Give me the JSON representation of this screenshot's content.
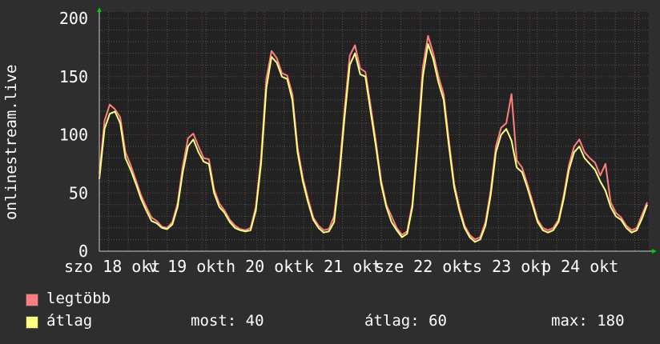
{
  "chart_data": {
    "type": "line",
    "ylabel": "onlinestream.live",
    "ylim": [
      0,
      200
    ],
    "yticks": [
      "0",
      "50",
      "100",
      "150",
      "200"
    ],
    "xtick_labels": [
      "szo 18 okt",
      "v 19 okt",
      "h 20 okt",
      "k 21 okt",
      "sze 22 okt",
      "cs 23 okt",
      "p 24 okt"
    ],
    "grid": true,
    "series": [
      {
        "name": "legtöbb",
        "color": "#ff7f7f",
        "values": [
          66,
          112,
          126,
          122,
          115,
          85,
          74,
          61,
          48,
          38,
          29,
          26,
          21,
          20,
          25,
          41,
          73,
          97,
          101,
          90,
          80,
          79,
          53,
          41,
          35,
          27,
          22,
          19,
          18,
          20,
          38,
          80,
          148,
          172,
          166,
          153,
          151,
          135,
          89,
          63,
          45,
          29,
          22,
          18,
          19,
          30,
          70,
          122,
          168,
          177,
          157,
          154,
          125,
          94,
          61,
          40,
          30,
          20,
          14,
          17,
          41,
          96,
          158,
          185,
          170,
          150,
          135,
          95,
          58,
          38,
          22,
          14,
          10,
          12,
          25,
          52,
          90,
          106,
          110,
          135,
          78,
          72,
          58,
          43,
          27,
          20,
          18,
          20,
          27,
          48,
          74,
          90,
          96,
          85,
          80,
          76,
          65,
          75,
          42,
          33,
          29,
          22,
          18,
          20,
          31,
          42
        ]
      },
      {
        "name": "átlag",
        "color": "#ffff7f",
        "values": [
          62,
          105,
          118,
          120,
          110,
          80,
          70,
          58,
          45,
          35,
          26,
          24,
          20,
          19,
          23,
          38,
          68,
          90,
          96,
          85,
          77,
          75,
          50,
          38,
          33,
          25,
          20,
          18,
          17,
          18,
          35,
          75,
          140,
          167,
          162,
          150,
          148,
          130,
          85,
          60,
          42,
          27,
          20,
          16,
          17,
          25,
          65,
          115,
          160,
          170,
          152,
          150,
          120,
          90,
          58,
          38,
          25,
          18,
          12,
          15,
          38,
          90,
          150,
          178,
          165,
          145,
          130,
          90,
          55,
          35,
          20,
          12,
          8,
          10,
          22,
          48,
          85,
          100,
          105,
          95,
          72,
          68,
          55,
          40,
          25,
          18,
          16,
          18,
          25,
          45,
          70,
          85,
          90,
          80,
          75,
          70,
          60,
          52,
          38,
          30,
          27,
          20,
          16,
          18,
          28,
          40
        ]
      }
    ]
  },
  "legend": {
    "items": [
      {
        "label": "legtöbb",
        "color": "#ff7f7f"
      },
      {
        "label": "átlag",
        "color": "#ffff7f"
      }
    ],
    "stats": {
      "now": "most: 40",
      "avg": "átlag: 60",
      "max": "max: 180"
    }
  }
}
